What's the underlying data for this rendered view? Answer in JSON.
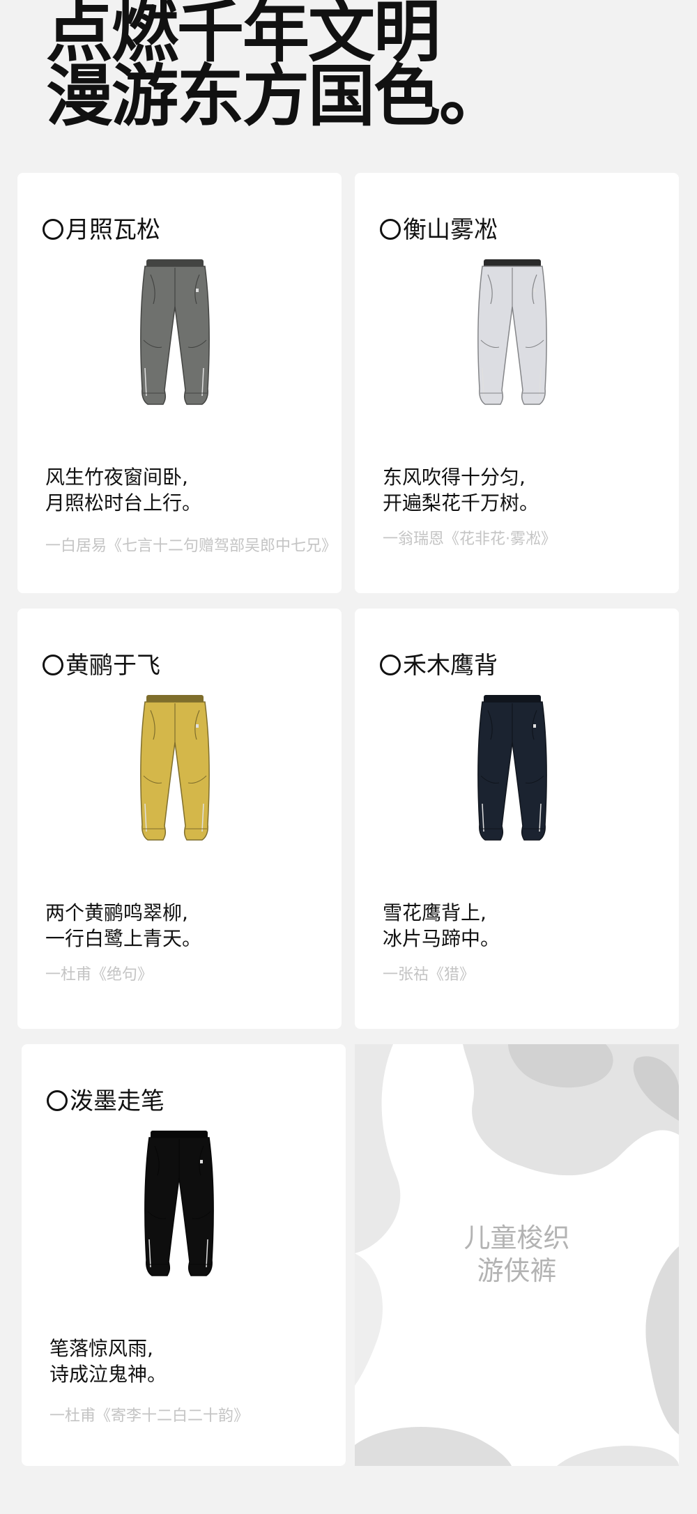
{
  "headline": {
    "line1": "点燃千年文明",
    "line2": "漫游东方国色。"
  },
  "cards": [
    {
      "name": "月照瓦松",
      "color": "#6f716e",
      "poem_line1": "风生竹夜窗间卧,",
      "poem_line2": "月照松时台上行。",
      "source": "一白居易《七言十二句赠驾部吴郎中七兄》"
    },
    {
      "name": "衡山雾凇",
      "color": "#dcdde2",
      "poem_line1": "东风吹得十分匀,",
      "poem_line2": "开遍梨花千万树。",
      "source": "一翁瑞恩《花非花·雾凇》"
    },
    {
      "name": "黄鹂于飞",
      "color": "#d4b74a",
      "poem_line1": "两个黄鹂鸣翠柳,",
      "poem_line2": "一行白鹭上青天。",
      "source": "一杜甫《绝句》"
    },
    {
      "name": "禾木鹰背",
      "color": "#1b2330",
      "poem_line1": "雪花鹰背上,",
      "poem_line2": "冰片马蹄中。",
      "source": "一张祜《猎》"
    },
    {
      "name": "泼墨走笔",
      "color": "#0e0e0e",
      "poem_line1": "笔落惊风雨,",
      "poem_line2": "诗成泣鬼神。",
      "source": "一杜甫《寄李十二白二十韵》"
    }
  ],
  "promo": {
    "line1": "儿童梭织",
    "line2": "游侠裤"
  }
}
